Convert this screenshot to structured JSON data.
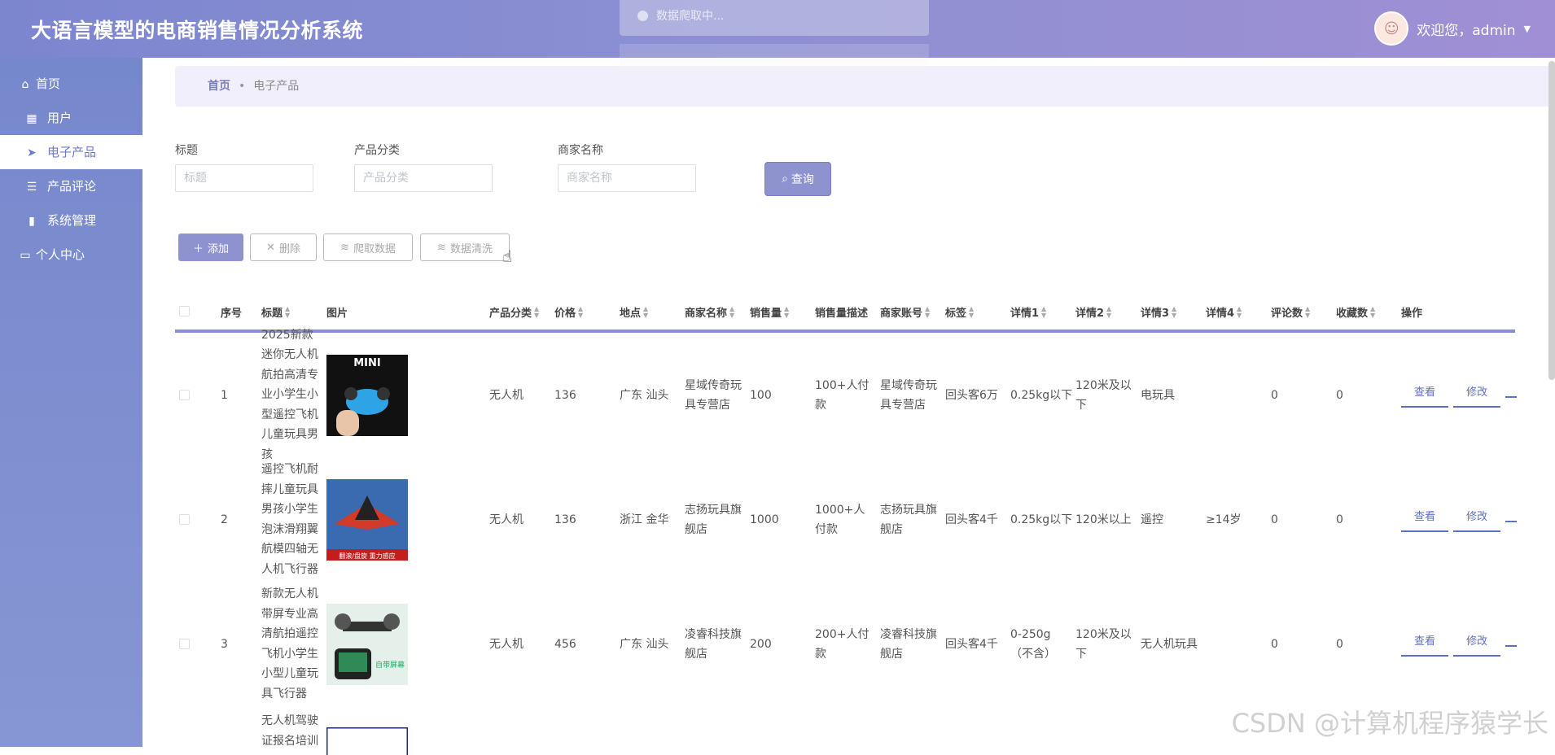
{
  "app": {
    "title": "大语言模型的电商销售情况分析系统",
    "user_greeting": "欢迎您，admin",
    "toast_text": "数据爬取中..."
  },
  "sidebar": {
    "items": [
      {
        "label": "首页",
        "icon": "home-icon"
      },
      {
        "label": "用户",
        "icon": "grid-icon"
      },
      {
        "label": "电子产品",
        "icon": "paper-plane-icon"
      },
      {
        "label": "产品评论",
        "icon": "list-icon"
      },
      {
        "label": "系统管理",
        "icon": "book-icon"
      },
      {
        "label": "个人中心",
        "icon": "id-card-icon"
      }
    ],
    "active": "电子产品"
  },
  "breadcrumb": {
    "home": "首页",
    "current": "电子产品"
  },
  "filters": {
    "title_label": "标题",
    "title_placeholder": "标题",
    "category_label": "产品分类",
    "category_placeholder": "产品分类",
    "merchant_label": "商家名称",
    "merchant_placeholder": "商家名称",
    "query_label": "查询"
  },
  "toolbar": {
    "add_label": "添加",
    "delete_label": "删除",
    "crawl_label": "爬取数据",
    "clean_label": "数据清洗"
  },
  "table": {
    "columns": [
      "序号",
      "标题",
      "图片",
      "产品分类",
      "价格",
      "地点",
      "商家名称",
      "销售量",
      "销售量描述",
      "商家账号",
      "标签",
      "详情1",
      "详情2",
      "详情3",
      "详情4",
      "评论数",
      "收藏数",
      "操作"
    ],
    "actions": {
      "view": "查看",
      "edit": "修改"
    },
    "rows": [
      {
        "index": "1",
        "title": "2025新款迷你无人机航拍高清专业小学生小型遥控飞机儿童玩具男孩",
        "image_text": "MINI",
        "category": "无人机",
        "price": "136",
        "location": "广东 汕头",
        "merchant": "星域传奇玩具专营店",
        "sales": "100",
        "sales_desc": "100+人付款",
        "account": "星域传奇玩具专营店",
        "tag": "回头客6万",
        "d1": "0.25kg以下",
        "d2": "120米及以下",
        "d3": "电玩具",
        "d4": "",
        "comments": "0",
        "favorites": "0"
      },
      {
        "index": "2",
        "title": "遥控飞机耐摔儿童玩具男孩小学生泡沫滑翔翼航模四轴无人机飞行器",
        "image_text": "翻滚/盘旋 重力感应",
        "category": "无人机",
        "price": "136",
        "location": "浙江 金华",
        "merchant": "志扬玩具旗舰店",
        "sales": "1000",
        "sales_desc": "1000+人付款",
        "account": "志扬玩具旗舰店",
        "tag": "回头客4千",
        "d1": "0.25kg以下",
        "d2": "120米以上",
        "d3": "遥控",
        "d4": "≥14岁",
        "comments": "0",
        "favorites": "0"
      },
      {
        "index": "3",
        "title": "新款无人机带屏专业高清航拍遥控飞机小学生小型儿童玩具飞行器",
        "image_text": "自带屏幕",
        "category": "无人机",
        "price": "456",
        "location": "广东 汕头",
        "merchant": "凌睿科技旗舰店",
        "sales": "200",
        "sales_desc": "200+人付款",
        "account": "凌睿科技旗舰店",
        "tag": "回头客4千",
        "d1": "0-250g（不含）",
        "d2": "120米及以下",
        "d3": "无人机玩具",
        "d4": "",
        "comments": "0",
        "favorites": "0"
      },
      {
        "index": "",
        "title": "无人机驾驶证报名培训"
      }
    ]
  },
  "watermark": "CSDN @计算机程序猿学长",
  "colors": {
    "header": "#8c8fd2",
    "sidebar": "#7a8bcf",
    "accent": "#8e92cf",
    "link": "#5e6fc8"
  }
}
